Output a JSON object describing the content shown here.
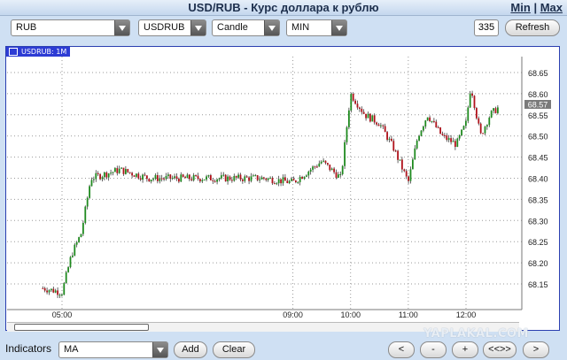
{
  "window": {
    "title": "USD/RUB - Курс доллара к рублю",
    "link_min": "Min",
    "separator": "|",
    "link_max": "Max"
  },
  "toolbar": {
    "currency": "RUB",
    "symbol": "USDRUB",
    "chart_type": "Candle",
    "interval": "MIN",
    "count": "335",
    "refresh_label": "Refresh"
  },
  "chart_panel": {
    "label": "USDRUB: 1M",
    "current_price": "68.57"
  },
  "chart_data": {
    "type": "candlestick",
    "symbol": "USDRUB",
    "ylim": [
      68.1,
      68.7
    ],
    "y_ticks": [
      "68.65",
      "68.60",
      "68.55",
      "68.50",
      "68.45",
      "68.40",
      "68.35",
      "68.30",
      "68.25",
      "68.20",
      "68.15"
    ],
    "x_ticks": [
      "05:00",
      "09:00",
      "10:00",
      "11:00",
      "12:00"
    ],
    "last_price": 68.57,
    "approx_close_path": [
      {
        "x": "04:40",
        "y": 68.14
      },
      {
        "x": "05:00",
        "y": 68.13
      },
      {
        "x": "05:10",
        "y": 68.22
      },
      {
        "x": "05:20",
        "y": 68.27
      },
      {
        "x": "05:30",
        "y": 68.4
      },
      {
        "x": "06:00",
        "y": 68.42
      },
      {
        "x": "06:30",
        "y": 68.4
      },
      {
        "x": "08:30",
        "y": 68.4
      },
      {
        "x": "09:00",
        "y": 68.39
      },
      {
        "x": "09:30",
        "y": 68.44
      },
      {
        "x": "09:50",
        "y": 68.4
      },
      {
        "x": "10:00",
        "y": 68.6
      },
      {
        "x": "10:15",
        "y": 68.55
      },
      {
        "x": "10:30",
        "y": 68.53
      },
      {
        "x": "10:45",
        "y": 68.47
      },
      {
        "x": "11:00",
        "y": 68.39
      },
      {
        "x": "11:10",
        "y": 68.5
      },
      {
        "x": "11:20",
        "y": 68.55
      },
      {
        "x": "11:35",
        "y": 68.5
      },
      {
        "x": "11:50",
        "y": 68.48
      },
      {
        "x": "12:00",
        "y": 68.53
      },
      {
        "x": "12:05",
        "y": 68.62
      },
      {
        "x": "12:15",
        "y": 68.5
      },
      {
        "x": "12:25",
        "y": 68.55
      },
      {
        "x": "12:35",
        "y": 68.57
      }
    ],
    "colors": {
      "up": "#1f8a1f",
      "down": "#b0121b",
      "grid": "#9a9a9a",
      "axis_text": "#222222"
    }
  },
  "indicators": {
    "label": "Indicators",
    "selected": "MA",
    "add_label": "Add",
    "clear_label": "Clear"
  },
  "nav": {
    "prev": "<",
    "zoom_out": "-",
    "zoom_in": "+",
    "rewind": "<<>>",
    "next": ">"
  },
  "watermark": "YAPLAKAL.COM"
}
